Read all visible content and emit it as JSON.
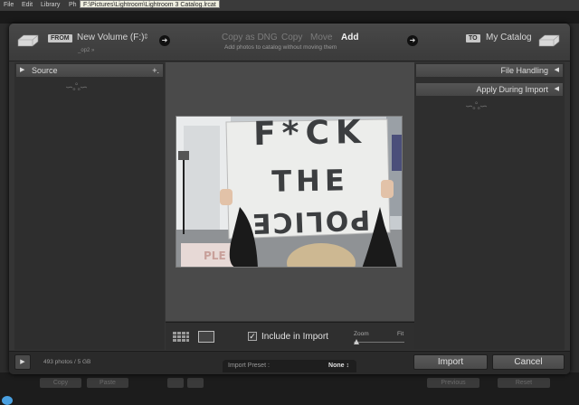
{
  "menu": {
    "items": [
      "File",
      "Edit",
      "Library",
      "Ph"
    ],
    "path_tooltip": "F:\\Pictures\\Lightroom\\Lightroom 3 Catalog.lrcat"
  },
  "header": {
    "from_tag": "FROM",
    "from_volume": "New Volume (F:)",
    "from_sub": "_op2 »",
    "modes": [
      "Copy as DNG",
      "Copy",
      "Move",
      "Add"
    ],
    "active_mode": "Add",
    "mode_description": "Add photos to catalog without moving them",
    "to_tag": "TO",
    "to_catalog": "My Catalog"
  },
  "left_panel": {
    "source_label": "Source",
    "add_symbol": "+."
  },
  "right_panel": {
    "file_handling": "File Handling",
    "apply_during_import": "Apply During Import"
  },
  "preview": {
    "sign_line1": "F*CK",
    "sign_line2": "THE",
    "sign_line3": "POLICE",
    "bg_sign_text": "PLE"
  },
  "toolbar": {
    "include_label": "Include in Import",
    "include_checked": true,
    "zoom_label": "Zoom",
    "fit_label": "Fit",
    "zoom_level": 0
  },
  "footer": {
    "count": "493 photos / 5 GB",
    "preset_label": "Import Preset :",
    "preset_value": "None ↕",
    "import_label": "Import",
    "cancel_label": "Cancel"
  },
  "background_buttons": [
    "Copy",
    "Paste",
    "Flag",
    "Sync",
    "Previous",
    "Reset"
  ],
  "colors": {
    "dialog": "#353535",
    "panel": "#2e2e2e",
    "accent_text": "#f2f2f2"
  }
}
